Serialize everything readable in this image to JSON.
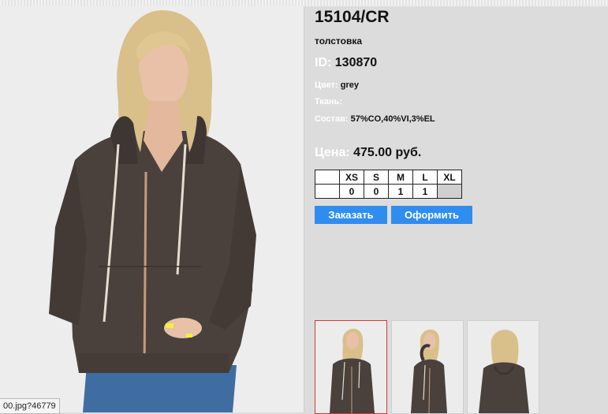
{
  "product": {
    "title": "15104/CR",
    "subtitle": "толстовка",
    "id_label": "ID:",
    "id_value": "130870",
    "color_label": "Цвет:",
    "color_value": "grey",
    "fabric_label": "Ткань:",
    "fabric_value": "",
    "composition_label": "Состав:",
    "composition_value": "57%CO,40%VI,3%EL",
    "price_label": "Цена:",
    "price_value": "475.00 руб."
  },
  "sizes": {
    "headers": [
      "XS",
      "S",
      "M",
      "L",
      "XL"
    ],
    "quantities": [
      "0",
      "0",
      "1",
      "1",
      ""
    ]
  },
  "buttons": {
    "order": "Заказать",
    "checkout": "Оформить"
  },
  "status_url": "00.jpg?46779",
  "colors": {
    "accent": "#2f8df0",
    "garment": "#4a413d",
    "background": "#dcdcdc",
    "active_thumb_border": "#d13a3a"
  }
}
